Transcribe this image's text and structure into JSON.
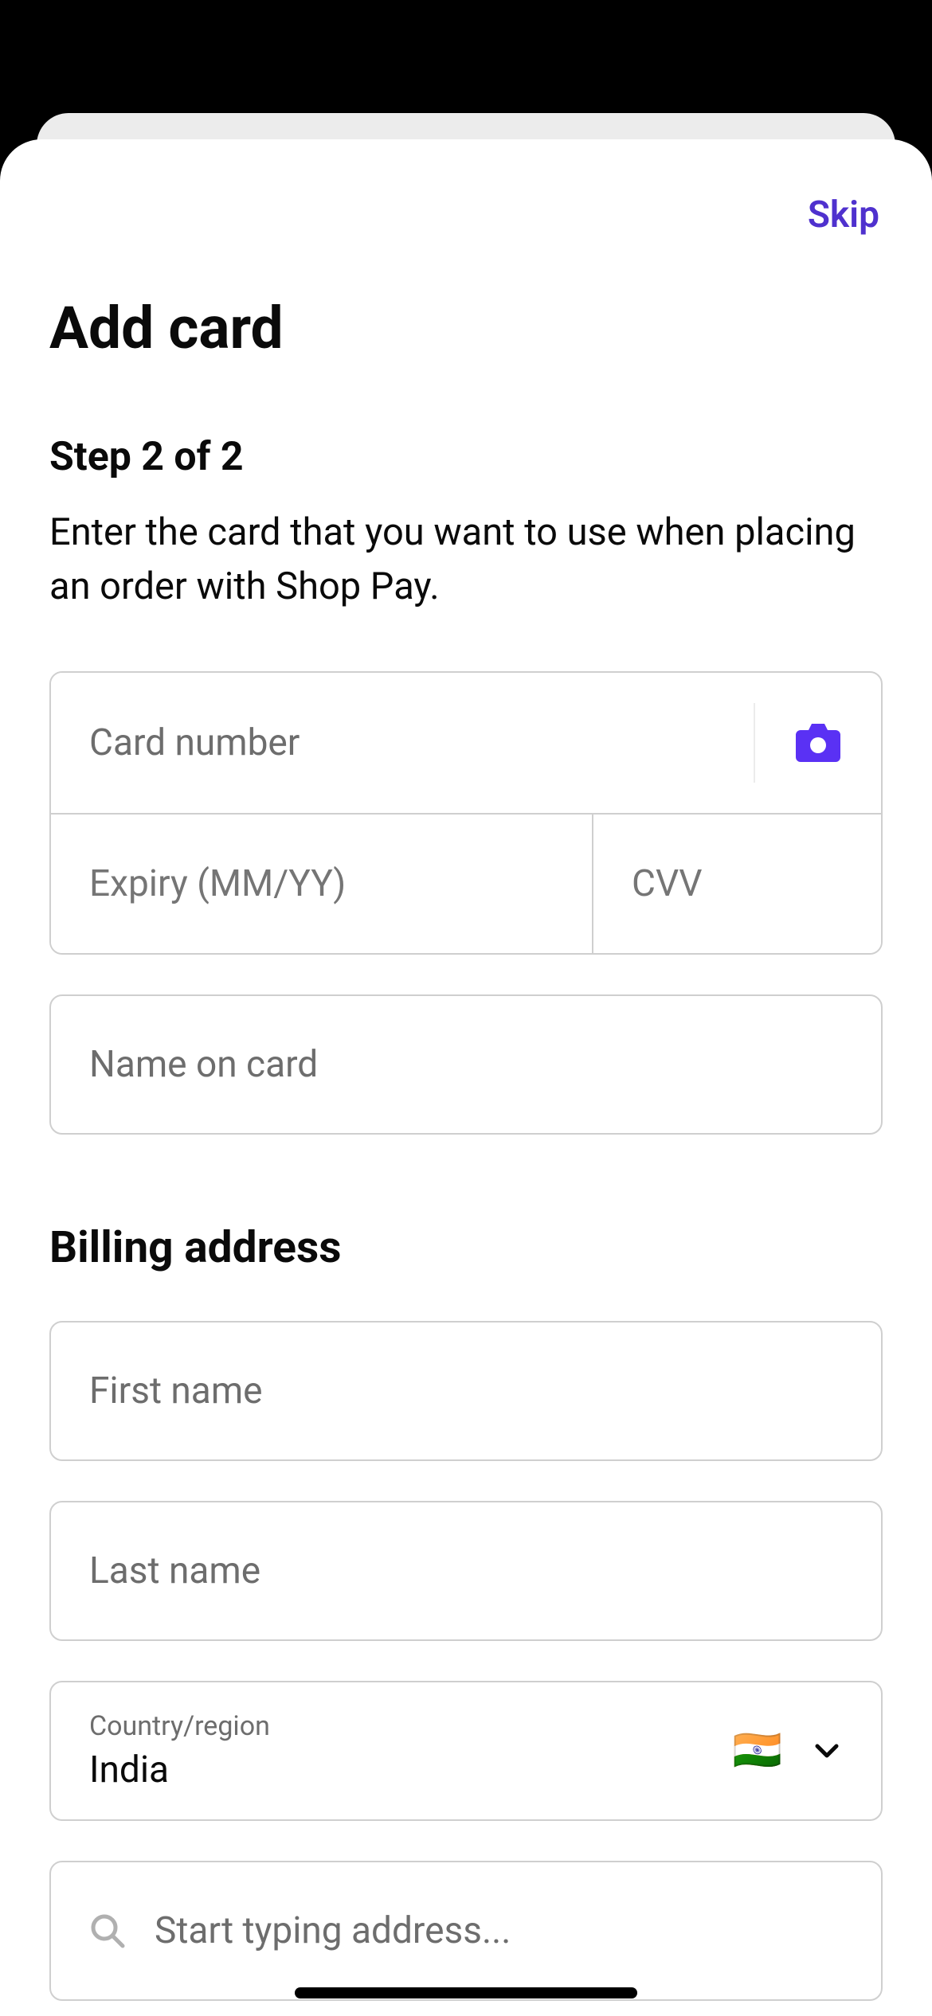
{
  "top": {
    "skip_label": "Skip"
  },
  "header": {
    "title": "Add card",
    "step": "Step 2 of 2",
    "description": "Enter the card that you want to use when placing an order with Shop Pay."
  },
  "card": {
    "number_placeholder": "Card number",
    "expiry_placeholder": "Expiry (MM/YY)",
    "cvv_placeholder": "CVV",
    "name_placeholder": "Name on card"
  },
  "billing": {
    "section_title": "Billing address",
    "first_name_placeholder": "First name",
    "last_name_placeholder": "Last name",
    "country_label": "Country/region",
    "country_value": "India",
    "country_flag": "🇮🇳",
    "address_placeholder": "Start typing address..."
  },
  "icons": {
    "accent": "#5A31F4"
  }
}
